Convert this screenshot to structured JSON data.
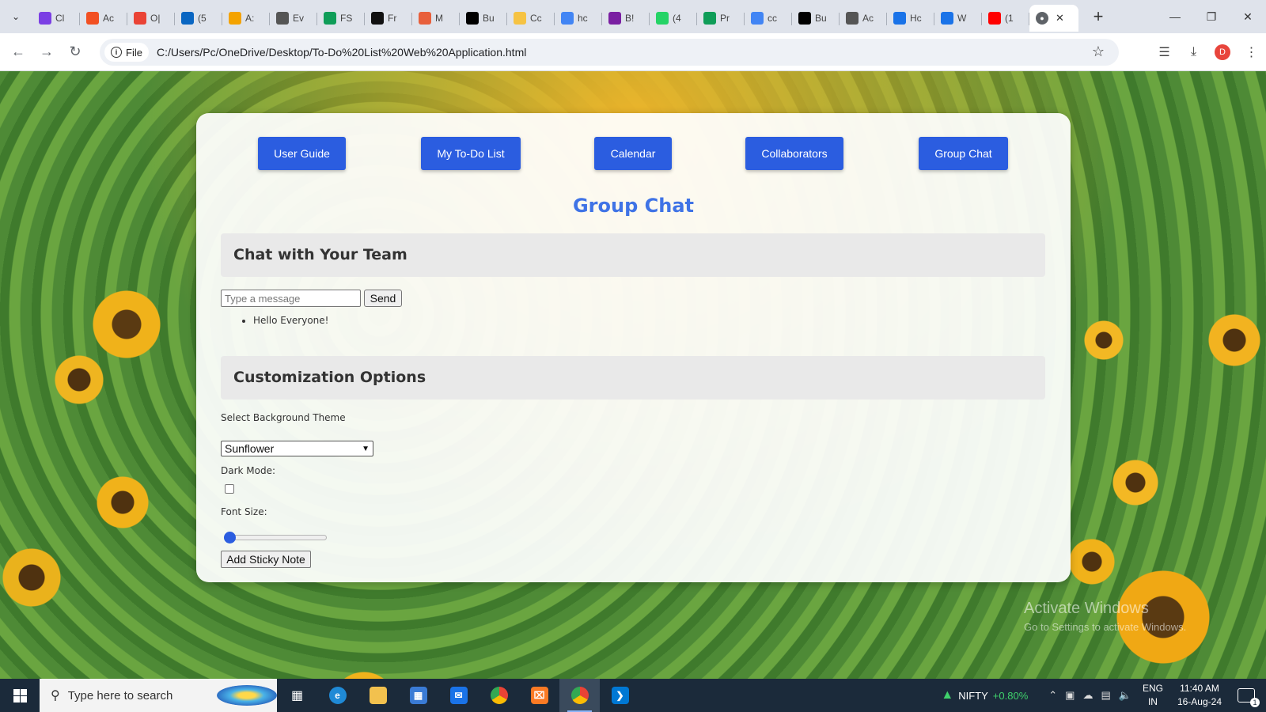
{
  "browser": {
    "tabs": [
      {
        "label": "Cl",
        "icon": "clipchamp-icon",
        "color": "#7b3fe4"
      },
      {
        "label": "Ac",
        "icon": "microsoft-icon",
        "color": "#f25022"
      },
      {
        "label": "O|",
        "icon": "gmail-icon",
        "color": "#ea4335"
      },
      {
        "label": "(5",
        "icon": "linkedin-icon",
        "color": "#0a66c2"
      },
      {
        "label": "A:",
        "icon": "pin-icon",
        "color": "#f4a300"
      },
      {
        "label": "Ev",
        "icon": "globe-icon",
        "color": "#555555"
      },
      {
        "label": "FS",
        "icon": "drive-icon",
        "color": "#0f9d58"
      },
      {
        "label": "Fr",
        "icon": "app-icon",
        "color": "#111111"
      },
      {
        "label": "M",
        "icon": "brain-icon",
        "color": "#e8603c"
      },
      {
        "label": "Bu",
        "icon": "dev-icon",
        "color": "#000000"
      },
      {
        "label": "Cc",
        "icon": "y-icon",
        "color": "#f6c343"
      },
      {
        "label": "hc",
        "icon": "google-icon",
        "color": "#4285f4"
      },
      {
        "label": "B!",
        "icon": "b12-icon",
        "color": "#7a1fa2"
      },
      {
        "label": "(4",
        "icon": "whatsapp-icon",
        "color": "#25d366"
      },
      {
        "label": "Pr",
        "icon": "drive-icon",
        "color": "#0f9d58"
      },
      {
        "label": "cc",
        "icon": "google-icon",
        "color": "#4285f4"
      },
      {
        "label": "Bu",
        "icon": "dev-icon",
        "color": "#000000"
      },
      {
        "label": "Ac",
        "icon": "globe-icon",
        "color": "#555555"
      },
      {
        "label": "Hc",
        "icon": "copilot-icon",
        "color": "#1a73e8"
      },
      {
        "label": "W",
        "icon": "copilot-icon",
        "color": "#1a73e8"
      },
      {
        "label": "(1",
        "icon": "youtube-icon",
        "color": "#ff0000"
      }
    ],
    "active_tab_icon": "globe-icon",
    "address": {
      "scheme_label": "File",
      "url": "C:/Users/Pc/OneDrive/Desktop/To-Do%20List%20Web%20Application.html"
    },
    "profile_initial": "D"
  },
  "app": {
    "nav": [
      {
        "label": "User Guide"
      },
      {
        "label": "My To-Do List"
      },
      {
        "label": "Calendar"
      },
      {
        "label": "Collaborators"
      },
      {
        "label": "Group Chat"
      }
    ],
    "page_title": "Group Chat",
    "chat": {
      "heading": "Chat with Your Team",
      "input_placeholder": "Type a message",
      "send_label": "Send",
      "messages": [
        "Hello Everyone!"
      ]
    },
    "customization": {
      "heading": "Customization Options",
      "theme_label": "Select Background Theme",
      "theme_selected": "Sunflower",
      "dark_mode_label": "Dark Mode:",
      "dark_mode_checked": false,
      "font_size_label": "Font Size:",
      "font_size_level": 0,
      "sticky_note_label": "Add Sticky Note"
    },
    "accent_color": "#2b5de0",
    "title_color": "#3f73e6"
  },
  "watermark": {
    "line1": "Activate Windows",
    "line2": "Go to Settings to activate Windows."
  },
  "taskbar": {
    "search_placeholder": "Type here to search",
    "ticker_name": "NIFTY",
    "ticker_change": "+0.80%",
    "lang_line1": "ENG",
    "lang_line2": "IN",
    "time": "11:40 AM",
    "date": "16-Aug-24",
    "notification_count": "1"
  }
}
